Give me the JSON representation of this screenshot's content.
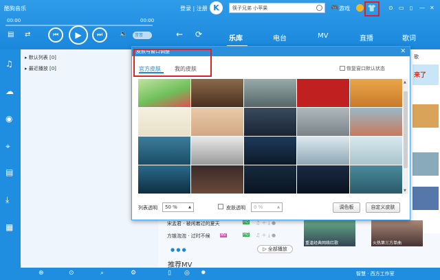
{
  "app": {
    "title": "酷狗音乐",
    "login": "登录 | 注册",
    "logo": "K"
  },
  "search": {
    "text": "筷子兄弟 小苹果"
  },
  "topright": {
    "game": "游戏",
    "window_buttons": [
      "⊙",
      "▭",
      "▯",
      "—",
      "✕"
    ]
  },
  "player": {
    "time_current": "00:00",
    "time_total": "00:00",
    "sound_label": "音音"
  },
  "nav_tabs": [
    "乐库",
    "电台",
    "MV",
    "直播",
    "歌词"
  ],
  "playlist": {
    "items": [
      "▸ 默认列表 [0]",
      "▸ 最近播放 [0]"
    ]
  },
  "main_rows": [
    {
      "text": "宋孟君 · 被闲着过的夏天",
      "badge": "HQ"
    },
    {
      "text": "方锥泡泡 · 过时不候",
      "badge": "HQ"
    }
  ],
  "main_thumbs": [
    "重逢经典网络红歌",
    "火热第三方单曲"
  ],
  "play_all": "▷ 全部播放",
  "rec_mv": "推荐MV",
  "watermark": "智慧 · 西方工作室",
  "right_col_labels": [
    "歌",
    "来了"
  ],
  "skin_dialog": {
    "title": "皮肤与窗口调整",
    "tab_official": "官方皮肤",
    "tab_my": "我的皮肤",
    "restore": "恢复窗口默认状态",
    "list_opacity_label": "列表透明",
    "list_opacity_value": "50 %",
    "skin_opacity_label": "皮肤透明",
    "skin_opacity_value": "0 %",
    "palette_button": "调色板",
    "custom_button": "自定义皮肤"
  },
  "colors": {
    "accent": "#1a87dc",
    "highlight": "#e02020"
  }
}
